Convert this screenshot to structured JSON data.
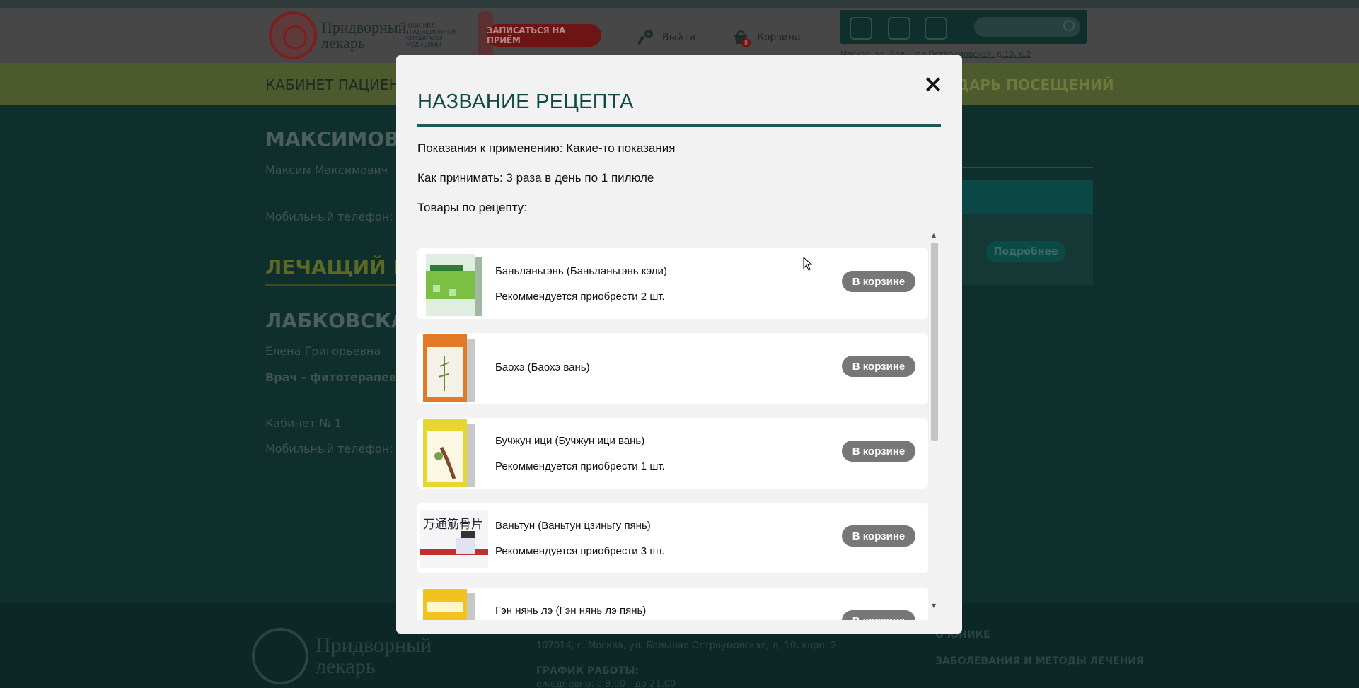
{
  "header": {
    "logo_title": "Придворный лекарь",
    "logo_subtitle": "КЛИНИКА ТРАДИЦИОННОЙ КИТАЙСКОЙ МЕДИЦИНЫ",
    "signup_label": "ЗАПИСАТЬСЯ НА ПРИЁМ",
    "logout_label": "Выйти",
    "cart_label": "Корзина",
    "cart_count": "8",
    "address": "Москва, ул. Большая Остроумовская, д.10, к.2"
  },
  "nav": {
    "left": "КАБИНЕТ ПАЦИЕНТ",
    "right": "ДАРЬ ПОСЕЩЕНИЙ"
  },
  "background": {
    "surname": "МАКСИМОВ",
    "patient_name": "Максим Максимович",
    "phone_label": "Мобильный телефон: +",
    "doctor_heading": "ЛЕЧАЩИЙ ВР",
    "doctor_surname": "ЛАБКОВСКАЯ",
    "doctor_name": "Елена Григорьевна",
    "doctor_role": "Врач - фитотерапевт",
    "cabinet": "Кабинет № 1",
    "phone_label2": "Мобильный телефон: +",
    "more_button": "Подробнее"
  },
  "footer": {
    "address": "107014, г. Москва, ул. Большая Остроумовская, д. 10, корп. 2",
    "schedule_title": "ГРАФИК РАБОТЫ:",
    "schedule_text": "ежедневно: с 9.00 - до 21.00",
    "link1": "О ЮНИКЕ",
    "link2": "ЗАБОЛЕВАНИЯ И МЕТОДЫ ЛЕЧЕНИЯ",
    "logo_title": "Придворный лекарь"
  },
  "modal": {
    "title": "НАЗВАНИЕ РЕЦЕПТА",
    "close_label": "×",
    "indications": "Показания к применению: Какие-то показания",
    "how_to_take": "Как принимать: 3 раза в день по 1 пилюле",
    "products_heading": "Товары по рецепту:",
    "items": [
      {
        "name": "Баньланьгэнь (Баньланьгэнь кэли)",
        "recommend": "Рекоммендуется приобрести 2 шт.",
        "button": "В корзине",
        "img_color": "#7bc043"
      },
      {
        "name": "Баохэ (Баохэ вань)",
        "recommend": "",
        "button": "В корзине",
        "img_color": "#e07a26"
      },
      {
        "name": "Бучжун ици (Бучжун ици вань)",
        "recommend": "Рекоммендуется приобрести 1 шт.",
        "button": "В корзине",
        "img_color": "#e8d630"
      },
      {
        "name": "Ваньтун (Ваньтун цзиньгу пянь)",
        "recommend": "Рекоммендуется приобрести 3 шт.",
        "button": "В корзине",
        "img_color": "#b0b0c8"
      },
      {
        "name": "Гэн нянь лэ (Гэн нянь лэ пянь)",
        "recommend": "",
        "button": "В корзине",
        "img_color": "#f2c21f"
      }
    ]
  },
  "colors": {
    "accent": "#0f4a47",
    "button_grey": "#777777",
    "overlay_dark": "#0f2f2c"
  }
}
